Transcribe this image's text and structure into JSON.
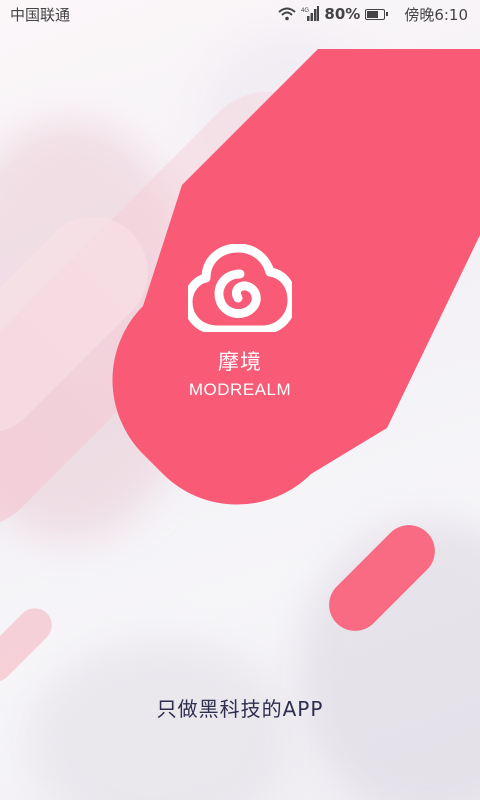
{
  "status_bar": {
    "carrier": "中国联通",
    "network": "4G",
    "battery_percent": "80%",
    "battery_level": 0.8,
    "time": "傍晚6:10",
    "icons": [
      "wifi-icon",
      "signal-icon",
      "battery-icon"
    ]
  },
  "splash": {
    "logo_icon": "cloud-swirl-icon",
    "app_name": "摩境",
    "app_name_en": "MODREALM",
    "slogan": "只做黑科技的APP"
  },
  "colors": {
    "accent": "#f95a75",
    "accent_light": "#f96b82",
    "slogan_text": "#2e2e4e",
    "background": "#f6f4f8"
  }
}
